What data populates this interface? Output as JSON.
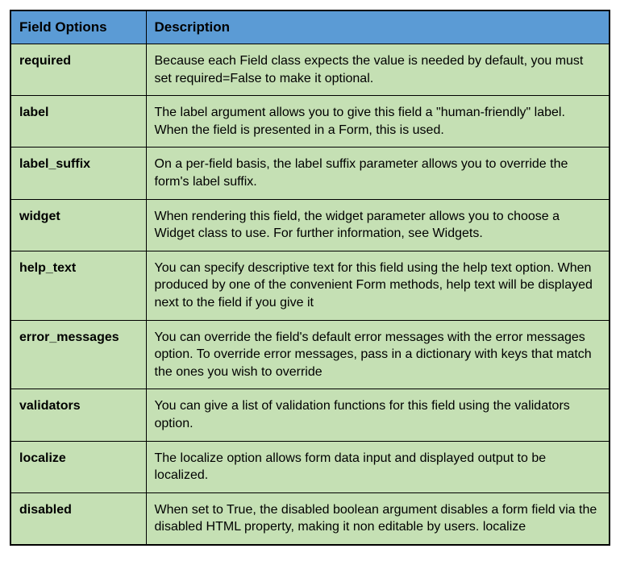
{
  "table": {
    "headers": {
      "col1": "Field Options",
      "col2": "Description"
    },
    "rows": [
      {
        "option": "required",
        "description": "Because each Field class expects the value is needed by default, you must set required=False to make it optional."
      },
      {
        "option": "label",
        "description": "The label argument allows you to give this field a \"human-friendly\" label. When the field is presented in a Form, this is used."
      },
      {
        "option": "label_suffix",
        "description": "On a per-field basis, the label suffix parameter allows you to override the form's label suffix."
      },
      {
        "option": "widget",
        "description": "When rendering this field, the widget parameter allows you to choose a Widget class to use. For further information, see Widgets."
      },
      {
        "option": "help_text",
        "description": "You can specify descriptive text for this field using the help text option. When produced by one of the convenient Form methods, help text will be displayed next to the field if you give it"
      },
      {
        "option": "error_messages",
        "description": "You can override the field's default error messages with the error messages option. To override error messages, pass in a dictionary with keys that match the ones you wish to override"
      },
      {
        "option": "validators",
        "description": "You can give a list of validation functions for this field using the validators option."
      },
      {
        "option": "localize",
        "description": "The localize option allows form data input and displayed output to be localized."
      },
      {
        "option": "disabled",
        "description": "When set to True, the disabled boolean argument disables a form field via the disabled HTML property, making it non editable by users. localize"
      }
    ]
  }
}
